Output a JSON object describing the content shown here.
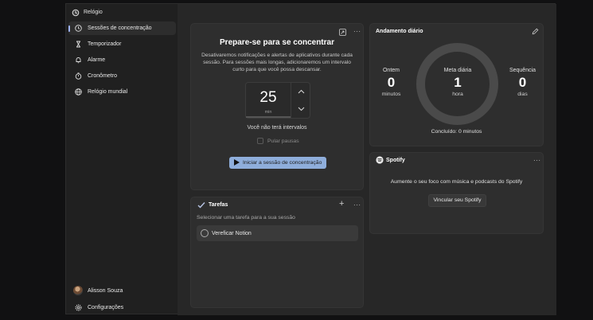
{
  "window": {
    "title": "Relógio",
    "controls": {
      "minimize": "─",
      "maximize": "☐",
      "close": "✕"
    }
  },
  "sidebar": {
    "items": [
      {
        "label": "Sessões de concentração",
        "icon": "focus-icon",
        "active": true
      },
      {
        "label": "Temporizador",
        "icon": "hourglass-icon"
      },
      {
        "label": "Alarme",
        "icon": "bell-icon"
      },
      {
        "label": "Cronômetro",
        "icon": "stopwatch-icon"
      },
      {
        "label": "Relógio mundial",
        "icon": "globe-icon"
      }
    ],
    "user": {
      "name": "Alisson Souza"
    },
    "settings_label": "Configurações"
  },
  "focus": {
    "title": "Prepare-se para se concentrar",
    "description_lines": [
      "Desativaremos notificações e alertas de aplicativos durante cada",
      "sessão. Para sessões mais longas, adicionaremos um intervalo",
      "curto para que você possa descansar."
    ],
    "timer_value": "25",
    "timer_unit": "min",
    "breaks_text": "Você não terá intervalos",
    "skip_breaks_label": "Pular pausas",
    "skip_breaks_checked": false,
    "start_button": "Iniciar a sessão de concentração",
    "more": "···"
  },
  "tasks": {
    "title": "Tarefas",
    "add": "+",
    "more": "···",
    "prompt": "Selecionar uma tarefa para a sua sessão",
    "items": [
      {
        "label": "Vereficar Notion",
        "done": false
      }
    ]
  },
  "daily": {
    "title": "Andamento diário",
    "yesterday": {
      "label": "Ontem",
      "value": "0",
      "unit": "minutos"
    },
    "goal": {
      "label": "Meta diária",
      "value": "1",
      "unit": "hora"
    },
    "streak": {
      "label": "Sequência",
      "value": "0",
      "unit": "dias"
    },
    "completed": "Concluído: 0 minutos",
    "progress": 0
  },
  "spotify": {
    "title": "Spotify",
    "more": "···",
    "message": "Aumente o seu foco com música e podcasts do Spotify",
    "link_button": "Vincular seu Spotify"
  },
  "colors": {
    "accent": "#8faedb",
    "window_bg": "#202020",
    "card_bg": "#2e2e2e"
  }
}
